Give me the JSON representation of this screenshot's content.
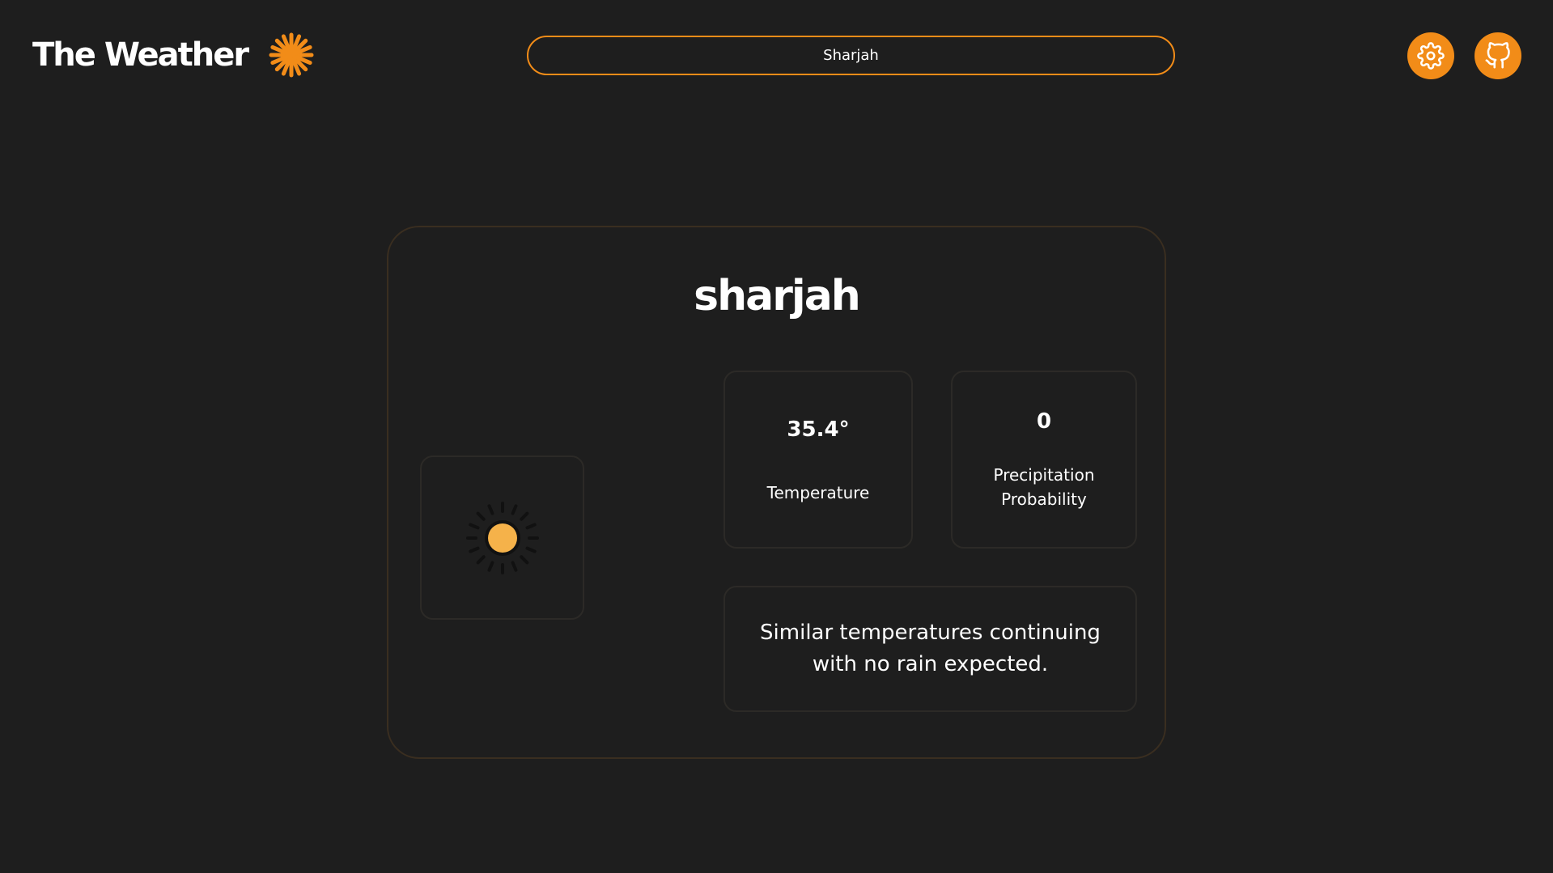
{
  "app": {
    "title": "The Weather",
    "accent_color": "#f28c18",
    "background_color": "#1e1e1e"
  },
  "header": {
    "logo_icon": "sunburst-icon",
    "search": {
      "value": "Sharjah",
      "placeholder": ""
    },
    "settings_icon": "gear-icon",
    "github_icon": "github-icon"
  },
  "weather": {
    "city": "sharjah",
    "condition_icon": "sun-icon",
    "temperature": {
      "value": "35.4°",
      "label": "Temperature"
    },
    "precipitation": {
      "value": "0",
      "label": "Precipitation Probability"
    },
    "summary": "Similar temperatures continuing with no rain expected."
  }
}
